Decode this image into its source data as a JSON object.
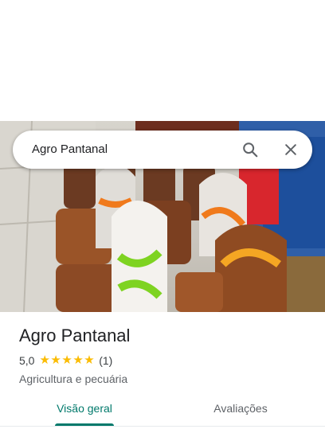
{
  "search": {
    "query": "Agro Pantanal"
  },
  "place": {
    "name": "Agro Pantanal",
    "rating": "5,0",
    "stars": [
      "★",
      "★",
      "★",
      "★",
      "★"
    ],
    "review_count": "(1)",
    "category": "Agricultura e pecuária"
  },
  "tabs": [
    {
      "label": "Visão geral",
      "active": true
    },
    {
      "label": "Avaliações",
      "active": false
    }
  ],
  "colors": {
    "accent": "#00796b",
    "star": "#fbbc04"
  },
  "icons": [
    "search-icon",
    "close-icon"
  ]
}
